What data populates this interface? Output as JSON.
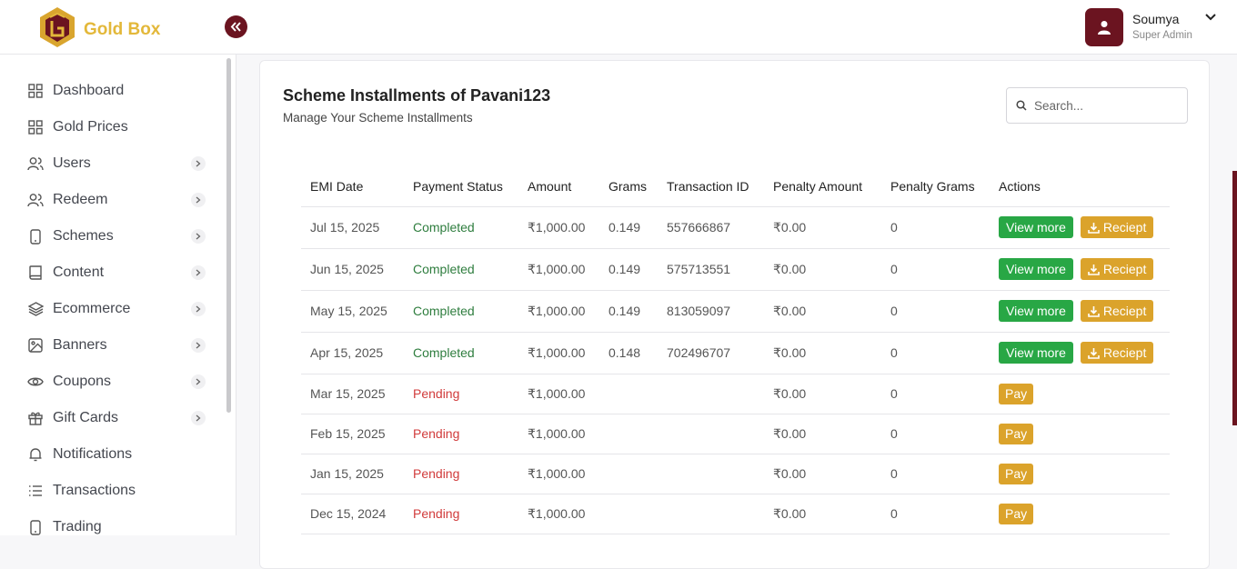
{
  "app": {
    "brand": "Gold Box"
  },
  "user": {
    "name": "Soumya",
    "role": "Super Admin"
  },
  "sidebar": {
    "items": [
      {
        "label": "Dashboard",
        "icon": "grid-icon",
        "has_children": false
      },
      {
        "label": "Gold Prices",
        "icon": "grid-icon",
        "has_children": false
      },
      {
        "label": "Users",
        "icon": "users-icon",
        "has_children": true
      },
      {
        "label": "Redeem",
        "icon": "users-icon",
        "has_children": true
      },
      {
        "label": "Schemes",
        "icon": "phone-icon",
        "has_children": true
      },
      {
        "label": "Content",
        "icon": "book-icon",
        "has_children": true
      },
      {
        "label": "Ecommerce",
        "icon": "layers-icon",
        "has_children": true
      },
      {
        "label": "Banners",
        "icon": "image-icon",
        "has_children": true
      },
      {
        "label": "Coupons",
        "icon": "eye-icon",
        "has_children": true
      },
      {
        "label": "Gift Cards",
        "icon": "gift-icon",
        "has_children": true
      },
      {
        "label": "Notifications",
        "icon": "bell-icon",
        "has_children": false
      },
      {
        "label": "Transactions",
        "icon": "list-icon",
        "has_children": false
      },
      {
        "label": "Trading",
        "icon": "phone-icon",
        "has_children": false
      }
    ]
  },
  "page": {
    "title": "Scheme Installments of Pavani123",
    "subtitle": "Manage Your Scheme Installments",
    "search_placeholder": "Search..."
  },
  "table": {
    "columns": [
      "EMI Date",
      "Payment Status",
      "Amount",
      "Grams",
      "Transaction ID",
      "Penalty Amount",
      "Penalty Grams",
      "Actions"
    ],
    "view_label": "View more",
    "receipt_label": "Reciept",
    "pay_label": "Pay",
    "rows": [
      {
        "date": "Jul 15, 2025",
        "status": "Completed",
        "amount": "₹1,000.00",
        "grams": "0.149",
        "txn": "557666867",
        "penalty_amount": "₹0.00",
        "penalty_grams": "0"
      },
      {
        "date": "Jun 15, 2025",
        "status": "Completed",
        "amount": "₹1,000.00",
        "grams": "0.149",
        "txn": "575713551",
        "penalty_amount": "₹0.00",
        "penalty_grams": "0"
      },
      {
        "date": "May 15, 2025",
        "status": "Completed",
        "amount": "₹1,000.00",
        "grams": "0.149",
        "txn": "813059097",
        "penalty_amount": "₹0.00",
        "penalty_grams": "0"
      },
      {
        "date": "Apr 15, 2025",
        "status": "Completed",
        "amount": "₹1,000.00",
        "grams": "0.148",
        "txn": "702496707",
        "penalty_amount": "₹0.00",
        "penalty_grams": "0"
      },
      {
        "date": "Mar 15, 2025",
        "status": "Pending",
        "amount": "₹1,000.00",
        "grams": "",
        "txn": "",
        "penalty_amount": "₹0.00",
        "penalty_grams": "0"
      },
      {
        "date": "Feb 15, 2025",
        "status": "Pending",
        "amount": "₹1,000.00",
        "grams": "",
        "txn": "",
        "penalty_amount": "₹0.00",
        "penalty_grams": "0"
      },
      {
        "date": "Jan 15, 2025",
        "status": "Pending",
        "amount": "₹1,000.00",
        "grams": "",
        "txn": "",
        "penalty_amount": "₹0.00",
        "penalty_grams": "0"
      },
      {
        "date": "Dec 15, 2024",
        "status": "Pending",
        "amount": "₹1,000.00",
        "grams": "",
        "txn": "",
        "penalty_amount": "₹0.00",
        "penalty_grams": "0"
      }
    ]
  },
  "colors": {
    "accent": "#6b1420",
    "brand_gold": "#e3b83a",
    "success": "#28a745",
    "warning": "#dba32b",
    "pending": "#d13b3b"
  }
}
